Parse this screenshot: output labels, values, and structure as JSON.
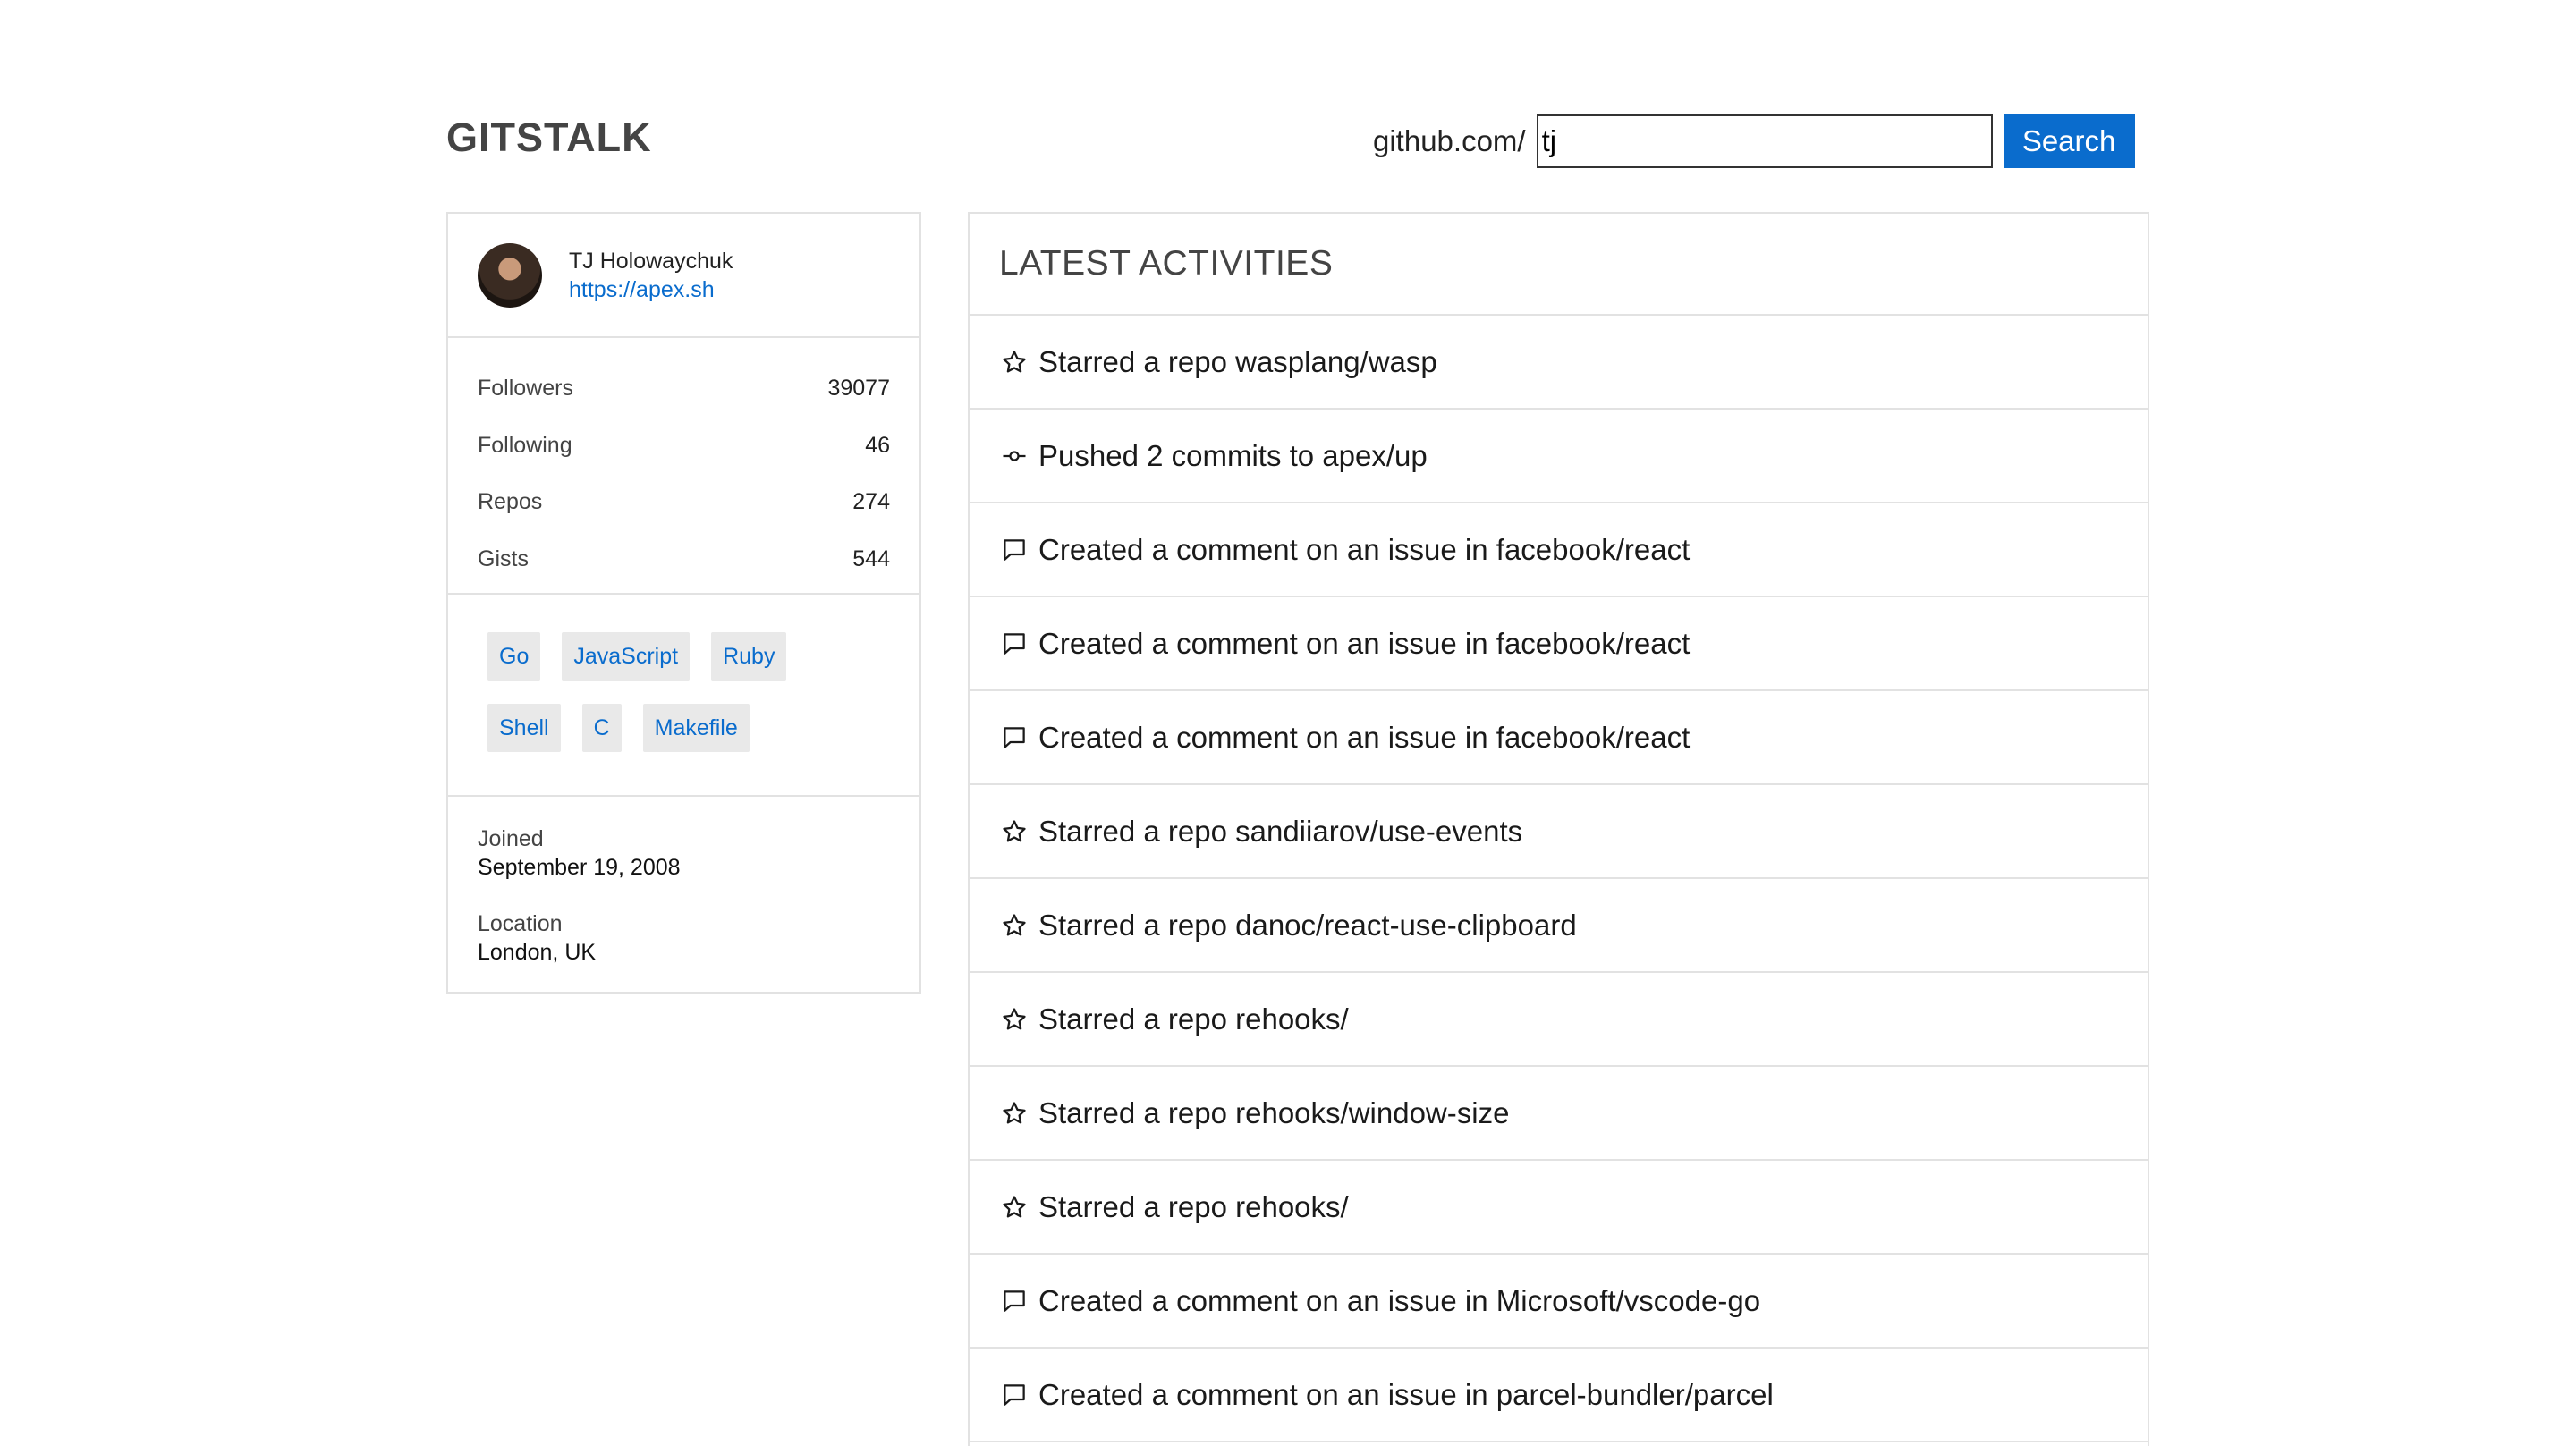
{
  "header": {
    "title": "GITSTALK",
    "search_prefix": "github.com/",
    "search_value": "tj",
    "search_button": "Search"
  },
  "profile": {
    "name": "TJ Holowaychuk",
    "link": "https://apex.sh",
    "stats": [
      {
        "label": "Followers",
        "value": "39077"
      },
      {
        "label": "Following",
        "value": "46"
      },
      {
        "label": "Repos",
        "value": "274"
      },
      {
        "label": "Gists",
        "value": "544"
      }
    ],
    "languages": [
      "Go",
      "JavaScript",
      "Ruby",
      "Shell",
      "C",
      "Makefile"
    ],
    "joined_label": "Joined",
    "joined_value": "September 19, 2008",
    "location_label": "Location",
    "location_value": "London, UK"
  },
  "activities": {
    "title": "LATEST ACTIVITIES",
    "items": [
      {
        "icon": "star-icon",
        "text": "Starred a repo wasplang/wasp"
      },
      {
        "icon": "commit-icon",
        "text": "Pushed 2 commits to apex/up"
      },
      {
        "icon": "comment-icon",
        "text": "Created a comment on an issue in facebook/react"
      },
      {
        "icon": "comment-icon",
        "text": "Created a comment on an issue in facebook/react"
      },
      {
        "icon": "comment-icon",
        "text": "Created a comment on an issue in facebook/react"
      },
      {
        "icon": "star-icon",
        "text": "Starred a repo sandiiarov/use-events"
      },
      {
        "icon": "star-icon",
        "text": "Starred a repo danoc/react-use-clipboard"
      },
      {
        "icon": "star-icon",
        "text": "Starred a repo rehooks/"
      },
      {
        "icon": "star-icon",
        "text": "Starred a repo rehooks/window-size"
      },
      {
        "icon": "star-icon",
        "text": "Starred a repo rehooks/"
      },
      {
        "icon": "comment-icon",
        "text": "Created a comment on an issue in Microsoft/vscode-go"
      },
      {
        "icon": "comment-icon",
        "text": "Created a comment on an issue in parcel-bundler/parcel"
      }
    ]
  }
}
